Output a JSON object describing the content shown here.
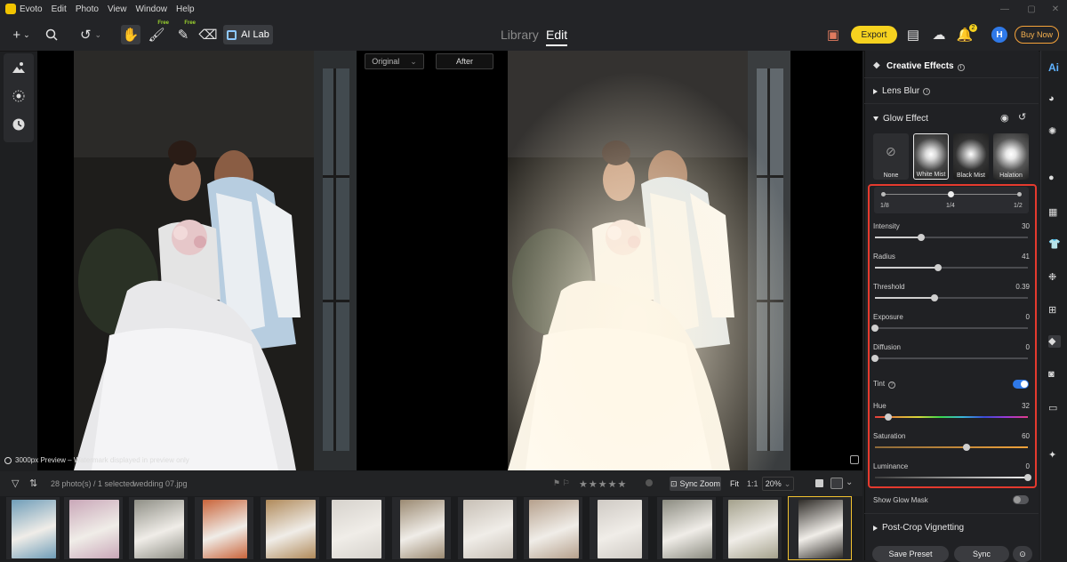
{
  "menubar": {
    "app_name": "Evoto",
    "items": [
      "Edit",
      "Photo",
      "View",
      "Window",
      "Help"
    ]
  },
  "toolbar": {
    "ai_lab_label": "AI Lab",
    "free_tag": "Free",
    "tabs": {
      "library": "Library",
      "edit": "Edit"
    },
    "export_label": "Export",
    "notif_count": "2",
    "avatar_initial": "H",
    "buy_now_label": "Buy Now"
  },
  "canvas": {
    "compare_original": "Original",
    "compare_after": "After",
    "preview_note": "3000px Preview – Watermark displayed in preview only"
  },
  "filmstrip_bar": {
    "count": "28 photo(s) / 1 selected",
    "folder": "wedding 07.jpg",
    "stars": "★★★★★",
    "sync_zoom": "Sync Zoom",
    "fit": "Fit",
    "ratio": "1:1",
    "zoom": "20%"
  },
  "filmstrip": {
    "thumbs": [
      {
        "color": "#6f9db8"
      },
      {
        "color": "#c9a7b8"
      },
      {
        "color": "#8f8f86"
      },
      {
        "color": "#c9643a"
      },
      {
        "color": "#b08a5a"
      },
      {
        "color": "#d6d2cc"
      },
      {
        "color": "#9b8a72"
      },
      {
        "color": "#c7bfb5"
      },
      {
        "color": "#b5a08c"
      },
      {
        "color": "#cfcac4"
      },
      {
        "color": "#8b8b80"
      },
      {
        "color": "#a4a18c"
      },
      {
        "color": "#2f2c28"
      }
    ],
    "selected_index": 12
  },
  "panel": {
    "title": "Creative Effects",
    "lens_blur": "Lens Blur",
    "glow_effect": "Glow Effect",
    "presets": [
      {
        "label": "None"
      },
      {
        "label": "White Mist"
      },
      {
        "label": "Black Mist"
      },
      {
        "label": "Halation"
      }
    ],
    "radius_pick": {
      "labels": [
        "1/8",
        "1/4",
        "1/2"
      ],
      "selected": 1
    },
    "sliders": [
      {
        "label": "Intensity",
        "value": "30",
        "fraction": 0.3
      },
      {
        "label": "Radius",
        "value": "41",
        "fraction": 0.41
      },
      {
        "label": "Threshold",
        "value": "0.39",
        "fraction": 0.39
      },
      {
        "label": "Exposure",
        "value": "0",
        "fraction": 0.0
      },
      {
        "label": "Diffusion",
        "value": "0",
        "fraction": 0.0
      }
    ],
    "tint_label": "Tint",
    "tint_on": true,
    "color_sliders": [
      {
        "label": "Hue",
        "value": "32",
        "fraction": 0.09
      },
      {
        "label": "Saturation",
        "value": "60",
        "fraction": 0.6
      },
      {
        "label": "Luminance",
        "value": "0",
        "fraction": 1.0
      }
    ],
    "show_glow_mask": "Show Glow Mask",
    "post_crop": "Post-Crop Vignetting",
    "save_preset": "Save Preset",
    "sync": "Sync"
  },
  "colors": {
    "accent": "#f6d21f",
    "highlight": "#e53a2e",
    "toggle_on": "#2f79e8"
  }
}
